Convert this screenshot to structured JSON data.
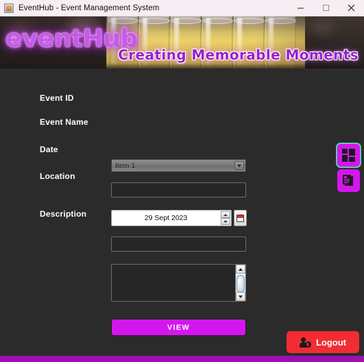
{
  "window": {
    "title": "EventHub - Event Management System",
    "app_icon": "java-app-icon",
    "minimize_label": "–",
    "maximize_label": "□",
    "close_label": "✕"
  },
  "banner": {
    "logo_text": "eventHub",
    "tagline": "Creating Memorable Moments",
    "photo_description": "champagne-glasses-photo"
  },
  "form": {
    "fields": [
      {
        "label": "Event ID",
        "type": "combobox",
        "value": "Item 1"
      },
      {
        "label": "Event Name",
        "type": "text",
        "value": ""
      },
      {
        "label": "Date",
        "type": "date",
        "value": "29 Sept 2023"
      },
      {
        "label": "Location",
        "type": "text",
        "value": ""
      },
      {
        "label": "Description",
        "type": "textarea",
        "value": ""
      }
    ],
    "view_button": "VIEW"
  },
  "sidebar": {
    "buttons": [
      {
        "name": "dashboard",
        "icon": "dashboard-grid-icon",
        "selected": true
      },
      {
        "name": "report",
        "icon": "document-report-icon",
        "selected": false
      }
    ]
  },
  "footer": {
    "logout_label": "Logout",
    "logout_icon": "user-logout-icon"
  },
  "colors": {
    "accent_magenta": "#d416ee",
    "bottom_strip_purple": "#9c0fae",
    "logout_red": "#f22c33",
    "panel_dark": "#2b2b2b",
    "titlebar_pink": "#f6eef2",
    "selection_outline": "#5ec7b8"
  }
}
